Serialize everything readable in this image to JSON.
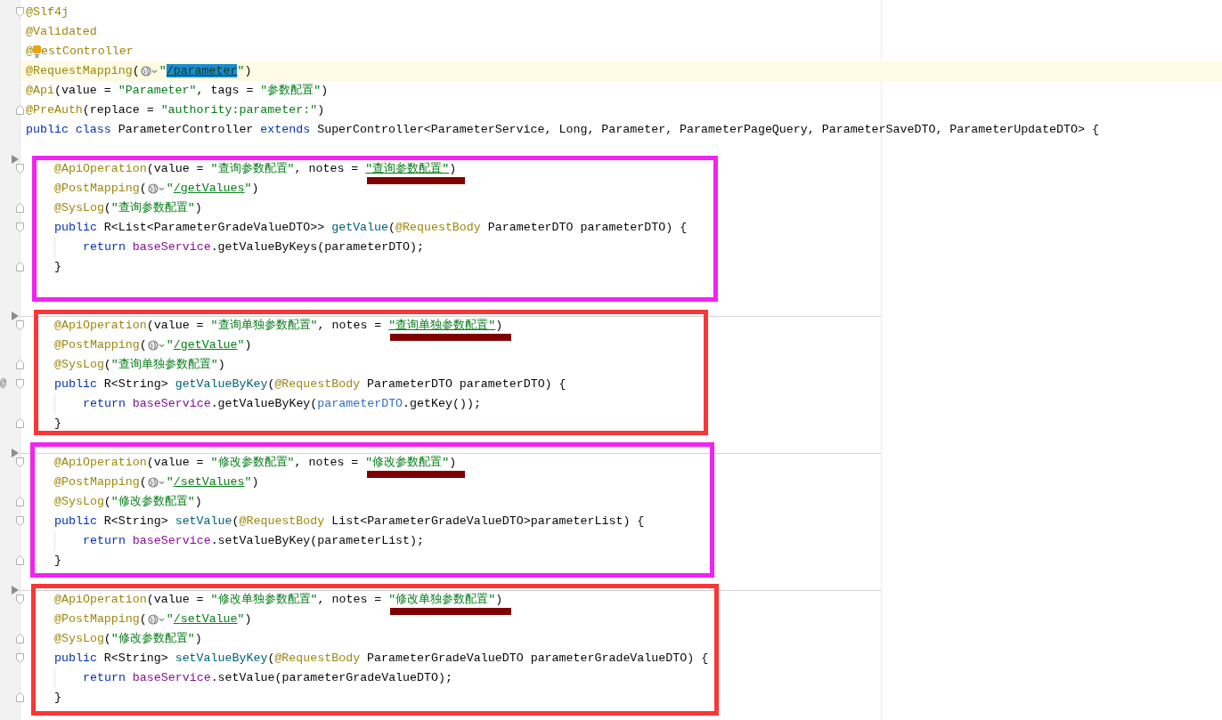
{
  "editor": {
    "header_lines": [
      {
        "fold_start": true,
        "tokens": [
          {
            "kind": "annotation",
            "text": "@Slf4j"
          }
        ]
      },
      {
        "tokens": [
          {
            "kind": "annotation",
            "text": "@Validated"
          }
        ]
      },
      {
        "tokens": [
          {
            "kind": "annotation",
            "text": "@"
          },
          {
            "kind": "bulb"
          },
          {
            "kind": "annotation",
            "text": "estController"
          }
        ]
      },
      {
        "current": true,
        "tokens": [
          {
            "kind": "annotation",
            "text": "@RequestMapping"
          },
          {
            "kind": "plain",
            "text": "("
          },
          {
            "kind": "globe"
          },
          {
            "kind": "string",
            "text": "\""
          },
          {
            "kind": "selection",
            "text": "/parameter"
          },
          {
            "kind": "string",
            "text": "\""
          },
          {
            "kind": "plain",
            "text": ")"
          }
        ]
      },
      {
        "tokens": [
          {
            "kind": "annotation",
            "text": "@Api"
          },
          {
            "kind": "plain",
            "text": "(value = "
          },
          {
            "kind": "string",
            "text": "\"Parameter\""
          },
          {
            "kind": "plain",
            "text": ", tags = "
          },
          {
            "kind": "string",
            "text": "\"参数配置\""
          },
          {
            "kind": "plain",
            "text": ")"
          }
        ]
      },
      {
        "fold_end": true,
        "tokens": [
          {
            "kind": "annotation",
            "text": "@PreAuth"
          },
          {
            "kind": "plain",
            "text": "(replace = "
          },
          {
            "kind": "string",
            "text": "\"authority:parameter:\""
          },
          {
            "kind": "plain",
            "text": ")"
          }
        ]
      },
      {
        "tokens": [
          {
            "kind": "keyword",
            "text": "public class "
          },
          {
            "kind": "plain",
            "text": "ParameterController "
          },
          {
            "kind": "keyword",
            "text": "extends "
          },
          {
            "kind": "plain",
            "text": "SuperController<ParameterService, Long, Parameter, ParameterPageQuery, ParameterSaveDTO, ParameterUpdateDTO> {"
          }
        ]
      }
    ],
    "blocks": [
      {
        "color": "#f222f2",
        "arrow": true,
        "separator": false,
        "lines": [
          {
            "fold_start": true,
            "tokens": [
              {
                "kind": "annotation",
                "text": "@ApiOperation"
              },
              {
                "kind": "plain",
                "text": "(value = "
              },
              {
                "kind": "string",
                "text": "\"查询参数配置\""
              },
              {
                "kind": "plain",
                "text": ", notes = "
              },
              {
                "kind": "link",
                "text": "\"查询参数配置\"",
                "underbar": true
              },
              {
                "kind": "plain",
                "text": ")"
              }
            ]
          },
          {
            "tokens": [
              {
                "kind": "annotation",
                "text": "@PostMapping"
              },
              {
                "kind": "plain",
                "text": "("
              },
              {
                "kind": "globe"
              },
              {
                "kind": "string",
                "text": "\""
              },
              {
                "kind": "link",
                "text": "/getValues"
              },
              {
                "kind": "string",
                "text": "\""
              },
              {
                "kind": "plain",
                "text": ")"
              }
            ]
          },
          {
            "fold_end": true,
            "tokens": [
              {
                "kind": "annotation",
                "text": "@SysLog"
              },
              {
                "kind": "plain",
                "text": "("
              },
              {
                "kind": "string",
                "text": "\"查询参数配置\""
              },
              {
                "kind": "plain",
                "text": ")"
              }
            ]
          },
          {
            "fold_start": true,
            "tokens": [
              {
                "kind": "keyword",
                "text": "public "
              },
              {
                "kind": "plain",
                "text": "R<List<ParameterGradeValueDTO>> "
              },
              {
                "kind": "method",
                "text": "getValue"
              },
              {
                "kind": "plain",
                "text": "("
              },
              {
                "kind": "annotation",
                "text": "@RequestBody"
              },
              {
                "kind": "plain",
                "text": " ParameterDTO parameterDTO) {"
              }
            ],
            "children": [
              {
                "tokens": [
                  {
                    "kind": "keyword",
                    "text": "return "
                  },
                  {
                    "kind": "field",
                    "text": "baseService"
                  },
                  {
                    "kind": "plain",
                    "text": ".getValueByKeys(parameterDTO);"
                  }
                ]
              }
            ]
          },
          {
            "fold_end": true,
            "tokens": [
              {
                "kind": "plain",
                "text": "}"
              }
            ]
          }
        ]
      },
      {
        "color": "#fa3636",
        "arrow": true,
        "separator": true,
        "lines": [
          {
            "fold_start": true,
            "tokens": [
              {
                "kind": "annotation",
                "text": "@ApiOperation"
              },
              {
                "kind": "plain",
                "text": "(value = "
              },
              {
                "kind": "string",
                "text": "\"查询单独参数配置\""
              },
              {
                "kind": "plain",
                "text": ", notes = "
              },
              {
                "kind": "link",
                "text": "\"查询单独参数配置\"",
                "underbar": true
              },
              {
                "kind": "plain",
                "text": ")"
              }
            ]
          },
          {
            "tokens": [
              {
                "kind": "annotation",
                "text": "@PostMapping"
              },
              {
                "kind": "plain",
                "text": "("
              },
              {
                "kind": "globe"
              },
              {
                "kind": "string",
                "text": "\""
              },
              {
                "kind": "link",
                "text": "/getValue"
              },
              {
                "kind": "string",
                "text": "\""
              },
              {
                "kind": "plain",
                "text": ")"
              }
            ]
          },
          {
            "fold_end": true,
            "tokens": [
              {
                "kind": "annotation",
                "text": "@SysLog"
              },
              {
                "kind": "plain",
                "text": "("
              },
              {
                "kind": "string",
                "text": "\"查询单独参数配置\""
              },
              {
                "kind": "plain",
                "text": ")"
              }
            ]
          },
          {
            "fold_start": true,
            "gutter_text": "@",
            "tokens": [
              {
                "kind": "keyword",
                "text": "public "
              },
              {
                "kind": "plain",
                "text": "R<String> "
              },
              {
                "kind": "method",
                "text": "getValueByKey"
              },
              {
                "kind": "plain",
                "text": "("
              },
              {
                "kind": "annotation",
                "text": "@RequestBody"
              },
              {
                "kind": "plain",
                "text": " ParameterDTO parameterDTO) {"
              }
            ],
            "children": [
              {
                "tokens": [
                  {
                    "kind": "keyword",
                    "text": "return "
                  },
                  {
                    "kind": "field",
                    "text": "baseService"
                  },
                  {
                    "kind": "plain",
                    "text": ".getValueByKey("
                  },
                  {
                    "kind": "param",
                    "text": "parameterDTO"
                  },
                  {
                    "kind": "plain",
                    "text": ".getKey());"
                  }
                ]
              }
            ]
          },
          {
            "fold_end": true,
            "tokens": [
              {
                "kind": "plain",
                "text": "}"
              }
            ]
          }
        ]
      },
      {
        "color": "#f222f2",
        "arrow": true,
        "separator": true,
        "lines": [
          {
            "fold_start": true,
            "tokens": [
              {
                "kind": "annotation",
                "text": "@ApiOperation"
              },
              {
                "kind": "plain",
                "text": "(value = "
              },
              {
                "kind": "string",
                "text": "\"修改参数配置\""
              },
              {
                "kind": "plain",
                "text": ", notes = "
              },
              {
                "kind": "string",
                "text": "\"修改参数配置\"",
                "underbar": true
              },
              {
                "kind": "plain",
                "text": ")"
              }
            ]
          },
          {
            "tokens": [
              {
                "kind": "annotation",
                "text": "@PostMapping"
              },
              {
                "kind": "plain",
                "text": "("
              },
              {
                "kind": "globe"
              },
              {
                "kind": "string",
                "text": "\""
              },
              {
                "kind": "link",
                "text": "/setValues"
              },
              {
                "kind": "string",
                "text": "\""
              },
              {
                "kind": "plain",
                "text": ")"
              }
            ]
          },
          {
            "fold_end": true,
            "tokens": [
              {
                "kind": "annotation",
                "text": "@SysLog"
              },
              {
                "kind": "plain",
                "text": "("
              },
              {
                "kind": "string",
                "text": "\"修改参数配置\""
              },
              {
                "kind": "plain",
                "text": ")"
              }
            ]
          },
          {
            "fold_start": true,
            "tokens": [
              {
                "kind": "keyword",
                "text": "public "
              },
              {
                "kind": "plain",
                "text": "R<String> "
              },
              {
                "kind": "method",
                "text": "setValue"
              },
              {
                "kind": "plain",
                "text": "("
              },
              {
                "kind": "annotation",
                "text": "@RequestBody"
              },
              {
                "kind": "plain",
                "text": " List<ParameterGradeValueDTO>parameterList) {"
              }
            ],
            "children": [
              {
                "tokens": [
                  {
                    "kind": "keyword",
                    "text": "return "
                  },
                  {
                    "kind": "field",
                    "text": "baseService"
                  },
                  {
                    "kind": "plain",
                    "text": ".setValueByKey(parameterList);"
                  }
                ]
              }
            ]
          },
          {
            "fold_end": true,
            "tokens": [
              {
                "kind": "plain",
                "text": "}"
              }
            ]
          }
        ]
      },
      {
        "color": "#fa3636",
        "arrow": true,
        "separator": true,
        "lines": [
          {
            "fold_start": true,
            "tokens": [
              {
                "kind": "annotation",
                "text": "@ApiOperation"
              },
              {
                "kind": "plain",
                "text": "(value = "
              },
              {
                "kind": "string",
                "text": "\"修改单独参数配置\""
              },
              {
                "kind": "plain",
                "text": ", notes = "
              },
              {
                "kind": "string",
                "text": "\"修改单独参数配置\"",
                "underbar": true
              },
              {
                "kind": "plain",
                "text": ")"
              }
            ]
          },
          {
            "tokens": [
              {
                "kind": "annotation",
                "text": "@PostMapping"
              },
              {
                "kind": "plain",
                "text": "("
              },
              {
                "kind": "globe"
              },
              {
                "kind": "string",
                "text": "\""
              },
              {
                "kind": "link",
                "text": "/setValue"
              },
              {
                "kind": "string",
                "text": "\""
              },
              {
                "kind": "plain",
                "text": ")"
              }
            ]
          },
          {
            "fold_end": true,
            "tokens": [
              {
                "kind": "annotation",
                "text": "@SysLog"
              },
              {
                "kind": "plain",
                "text": "("
              },
              {
                "kind": "string",
                "text": "\"修改参数配置\""
              },
              {
                "kind": "plain",
                "text": ")"
              }
            ]
          },
          {
            "fold_start": true,
            "tokens": [
              {
                "kind": "keyword",
                "text": "public "
              },
              {
                "kind": "plain",
                "text": "R<String> "
              },
              {
                "kind": "method",
                "text": "setValueByKey"
              },
              {
                "kind": "plain",
                "text": "("
              },
              {
                "kind": "annotation",
                "text": "@RequestBody"
              },
              {
                "kind": "plain",
                "text": " ParameterGradeValueDTO parameterGradeValueDTO) {"
              }
            ],
            "children": [
              {
                "tokens": [
                  {
                    "kind": "keyword",
                    "text": "return "
                  },
                  {
                    "kind": "field",
                    "text": "baseService"
                  },
                  {
                    "kind": "plain",
                    "text": ".setValue(parameterGradeValueDTO);"
                  }
                ]
              }
            ]
          },
          {
            "fold_end": true,
            "tokens": [
              {
                "kind": "plain",
                "text": "}"
              }
            ]
          }
        ]
      }
    ]
  }
}
